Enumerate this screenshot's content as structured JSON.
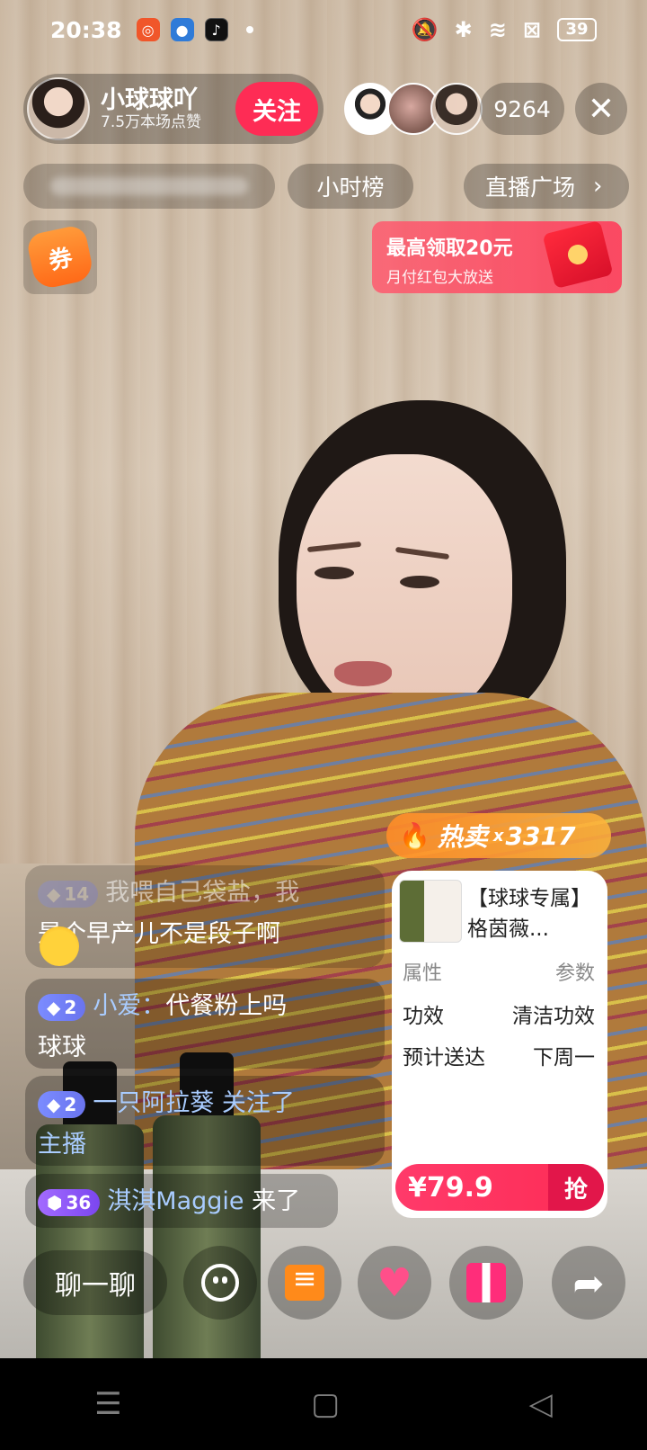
{
  "status_bar": {
    "time": "20:38",
    "battery": "39",
    "app_icons": [
      "recorder-app-icon",
      "browser-app-icon",
      "tiktok-app-icon"
    ]
  },
  "host": {
    "name": "小球球吖",
    "likes": "7.5万本场点赞",
    "follow_label": "关注",
    "viewer_count": "9264"
  },
  "nav_pills": {
    "rank_label": "小时榜",
    "plaza_label": "直播广场"
  },
  "coupon": {
    "label": "券"
  },
  "red_packet": {
    "title": "最高领取20元",
    "subtitle": "月付红包大放送"
  },
  "chat": [
    {
      "level": "14",
      "text_line1": "我喂自己袋盐，我",
      "text_line2": "是个早产儿不是段子啊"
    },
    {
      "level": "2",
      "user": "小爱：",
      "text_line1": "代餐粉上吗",
      "text_line2": "球球"
    },
    {
      "level": "2",
      "user": "一只阿拉葵",
      "text_line1": " 关注了",
      "text_line2": "主播"
    },
    {
      "level": "36",
      "user": "淇淇Maggie",
      "text_line1": " 来了"
    }
  ],
  "product": {
    "hot_label": "热卖",
    "hot_multiplier": "x",
    "hot_count": "3317",
    "title": "【球球专属】格茵薇...",
    "attr_header_left": "属性",
    "attr_header_right": "参数",
    "specs": [
      {
        "key": "功效",
        "value": "清洁功效"
      },
      {
        "key": "预计送达",
        "value": "下周一"
      }
    ],
    "price": "¥79.9",
    "buy_label": "抢"
  },
  "bottom_bar": {
    "chat_placeholder": "聊一聊"
  },
  "colors": {
    "accent": "#fe2c55",
    "hot": "#ff8c28",
    "username": "#a9ccff"
  }
}
